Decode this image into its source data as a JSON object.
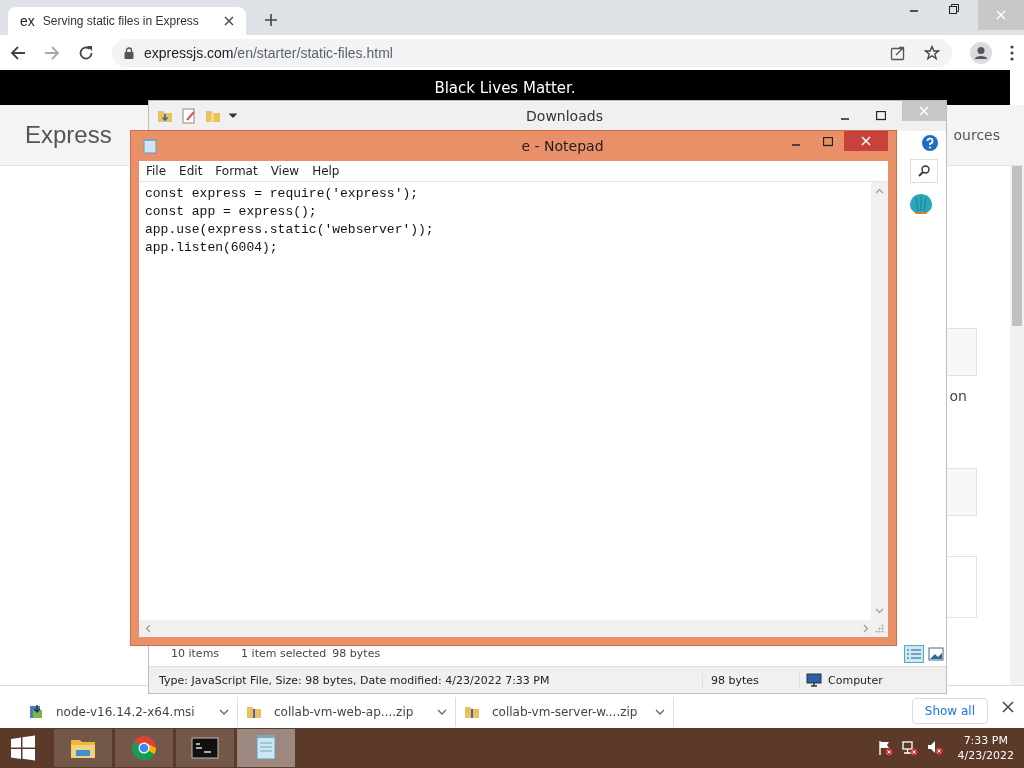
{
  "browser": {
    "tab": {
      "favicon": "ex",
      "title": "Serving static files in Express"
    },
    "url_host": "expressjs.com",
    "url_path": "/en/starter/static-files.html"
  },
  "page": {
    "banner": "Black Lives Matter.",
    "logo": "Express",
    "nav_fragment": "ources",
    "body_fragment": "on"
  },
  "downloads_bar": {
    "items": [
      {
        "name": "node-v16.14.2-x64.msi",
        "kind": "installer"
      },
      {
        "name": "collab-vm-web-ap....zip",
        "kind": "archive"
      },
      {
        "name": "collab-vm-server-w....zip",
        "kind": "archive"
      }
    ],
    "show_all": "Show all"
  },
  "explorer": {
    "title": "Downloads",
    "item_count": "10 items",
    "selection": "1 item selected",
    "selection_size": "98 bytes",
    "details": "Type: JavaScript File, Size: 98 bytes, Date modified: 4/23/2022 7:33 PM",
    "size": "98 bytes",
    "location": "Computer"
  },
  "notepad": {
    "title": "e - Notepad",
    "menu": [
      "File",
      "Edit",
      "Format",
      "View",
      "Help"
    ],
    "content": [
      "const express = require('express');",
      "const app = express();",
      "app.use(express.static('webserver'));",
      "app.listen(6004);"
    ]
  },
  "taskbar": {
    "apps": [
      {
        "kind": "explorer",
        "selected": false
      },
      {
        "kind": "chrome",
        "selected": false
      },
      {
        "kind": "console",
        "selected": false
      },
      {
        "kind": "notepad",
        "selected": true
      }
    ],
    "time": "7:33 PM",
    "date": "4/23/2022"
  }
}
